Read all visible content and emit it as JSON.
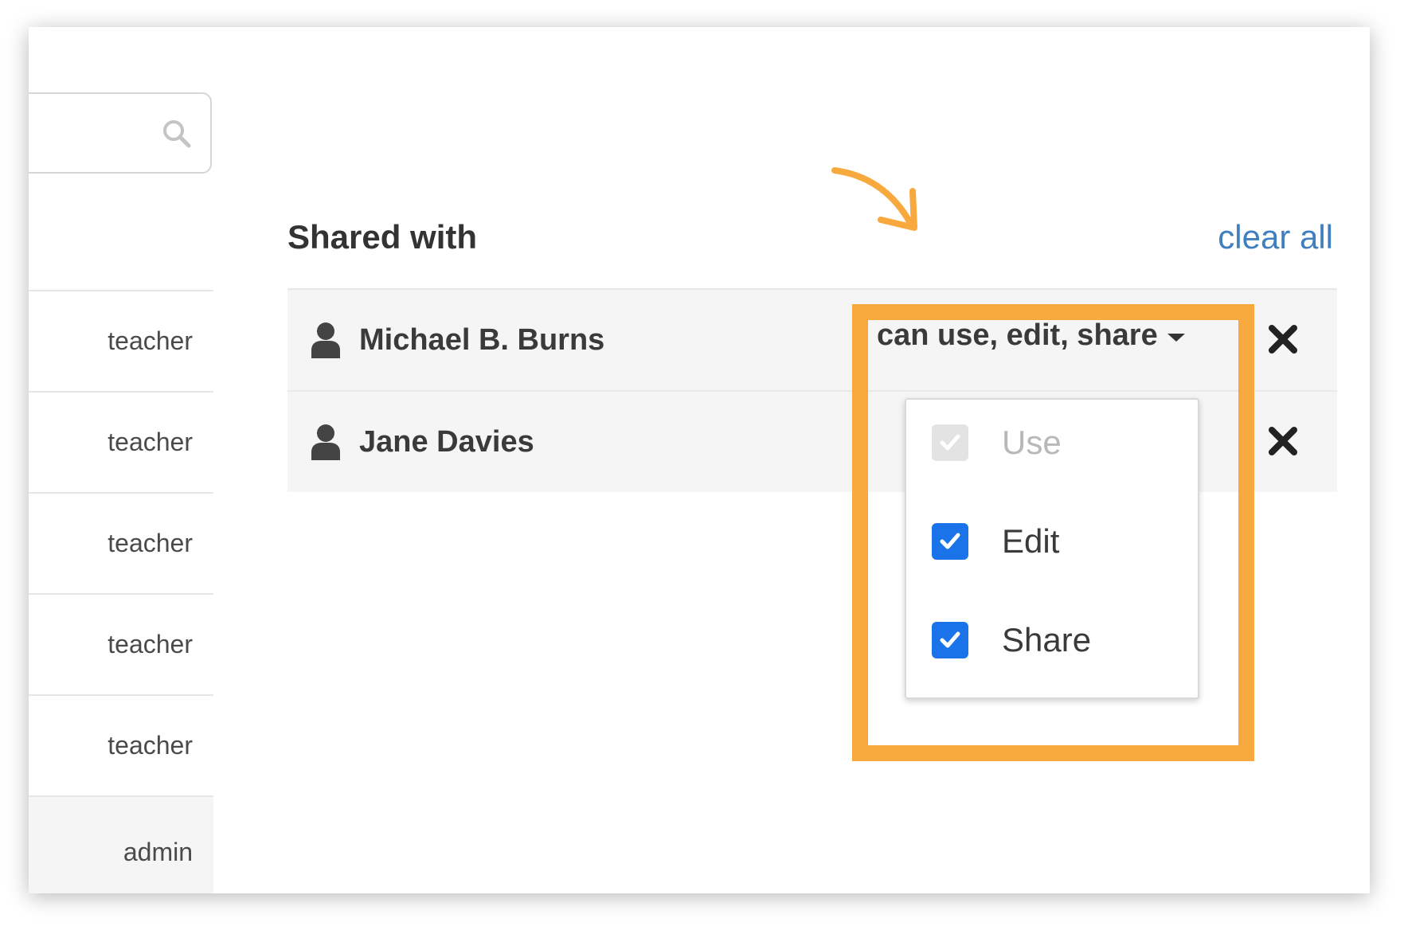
{
  "left_list": {
    "roles": [
      "teacher",
      "teacher",
      "teacher",
      "teacher",
      "teacher",
      "admin"
    ]
  },
  "shared": {
    "title": "Shared with",
    "clear_all_label": "clear all",
    "entries": [
      {
        "name": "Michael B. Burns",
        "permission_label": "can use, edit, share"
      },
      {
        "name": "Jane Davies"
      }
    ]
  },
  "permission_menu": {
    "items": [
      {
        "label": "Use",
        "checked": true,
        "disabled": true
      },
      {
        "label": "Edit",
        "checked": true,
        "disabled": false
      },
      {
        "label": "Share",
        "checked": true,
        "disabled": false
      }
    ]
  },
  "colors": {
    "highlight": "#f8a93e",
    "link": "#3f7fbf",
    "checkbox": "#1a73e8"
  }
}
